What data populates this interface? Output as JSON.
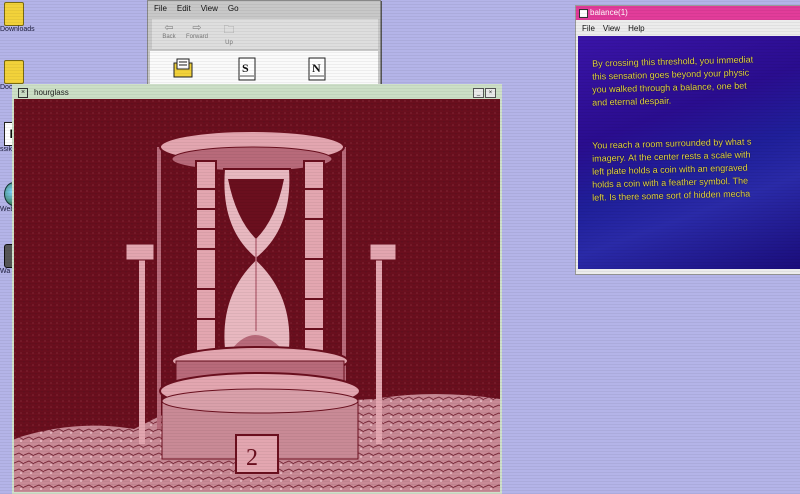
{
  "desktop": {
    "icons": [
      {
        "label": "Downloads",
        "icon": "folder-icon"
      },
      {
        "label": "Docu",
        "icon": "folder-icon"
      },
      {
        "label": "ssik",
        "icon": "notepad-icon"
      },
      {
        "label": "Web",
        "icon": "globe-icon"
      },
      {
        "label": "Wa",
        "icon": "speaker-icon"
      }
    ]
  },
  "explorer": {
    "menu": [
      "File",
      "Edit",
      "View",
      "Go"
    ],
    "toolbar": [
      {
        "label": "Back",
        "icon": "back-arrow-icon"
      },
      {
        "label": "Forward",
        "icon": "forward-arrow-icon"
      },
      {
        "label": "Up",
        "icon": "up-folder-icon"
      }
    ],
    "files": [
      {
        "icon": "notepad-folder-icon"
      },
      {
        "icon": "s-document-icon"
      },
      {
        "icon": "n-document-icon"
      }
    ]
  },
  "hourglass_window": {
    "title": "hourglass",
    "image": "hourglass-scene-image",
    "colors": {
      "dark": "#6a0f1e",
      "light": "#e3a6b0",
      "mid": "#b86a7a"
    }
  },
  "balance_window": {
    "title": "balance(1)",
    "menu": [
      "File",
      "View",
      "Help"
    ],
    "lines_p1": [
      "By crossing this threshold, you immediat",
      "this sensation goes beyond your physic",
      "you walked through a balance, one bet",
      "and eternal despair."
    ],
    "lines_p2": [
      "You reach a room surrounded by what s",
      "imagery. At the center rests a scale with",
      "left plate holds a coin with an engraved",
      "holds a coin with a feather symbol. The",
      "left. Is there some sort of hidden mecha"
    ],
    "colors": {
      "text": "#e8d84a",
      "title_bar": "#e23c9a"
    }
  }
}
